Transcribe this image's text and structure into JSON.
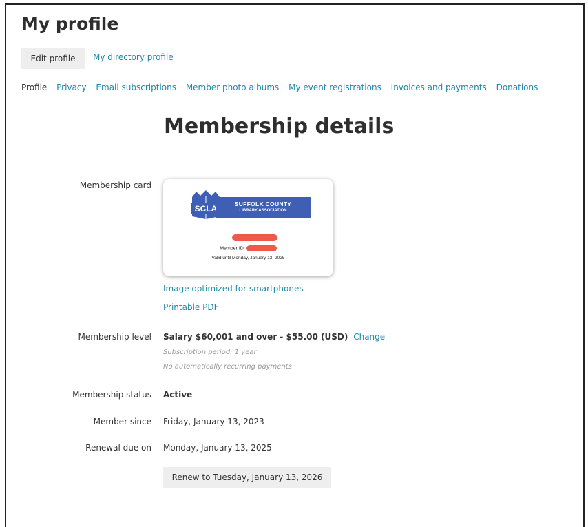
{
  "page": {
    "title": "My profile"
  },
  "top_tabs": {
    "edit_profile": "Edit profile",
    "directory_profile": "My directory profile"
  },
  "subnav": {
    "current": "Profile",
    "links": [
      "Privacy",
      "Email subscriptions",
      "Member photo albums",
      "My event registrations",
      "Invoices and payments",
      "Donations"
    ]
  },
  "section": {
    "title": "Membership details"
  },
  "membership_card": {
    "label": "Membership card",
    "logo_abbr": "SCLA",
    "logo_line1": "SUFFOLK COUNTY",
    "logo_line2": "LIBRARY ASSOCIATION",
    "member_id_label": "Member ID:",
    "valid_until": "Valid until Monday, January 13, 2025",
    "link_smartphone": "Image optimized for smartphones",
    "link_pdf": "Printable PDF"
  },
  "membership_level": {
    "label": "Membership level",
    "value": "Salary $60,001 and over - $55.00 (USD)",
    "change_link": "Change",
    "subscription_period": "Subscription period: 1 year",
    "recurring_note": "No automatically recurring payments"
  },
  "membership_status": {
    "label": "Membership status",
    "value": "Active"
  },
  "member_since": {
    "label": "Member since",
    "value": "Friday, January 13, 2023"
  },
  "renewal_due": {
    "label": "Renewal due on",
    "value": "Monday, January 13, 2025"
  },
  "renew_button": {
    "label": "Renew to Tuesday, January 13, 2026"
  },
  "colors": {
    "link": "#1f8aa6",
    "logo_blue": "#3f5fb4",
    "redaction": "#f0584b",
    "button_bg": "#eeeeee"
  }
}
